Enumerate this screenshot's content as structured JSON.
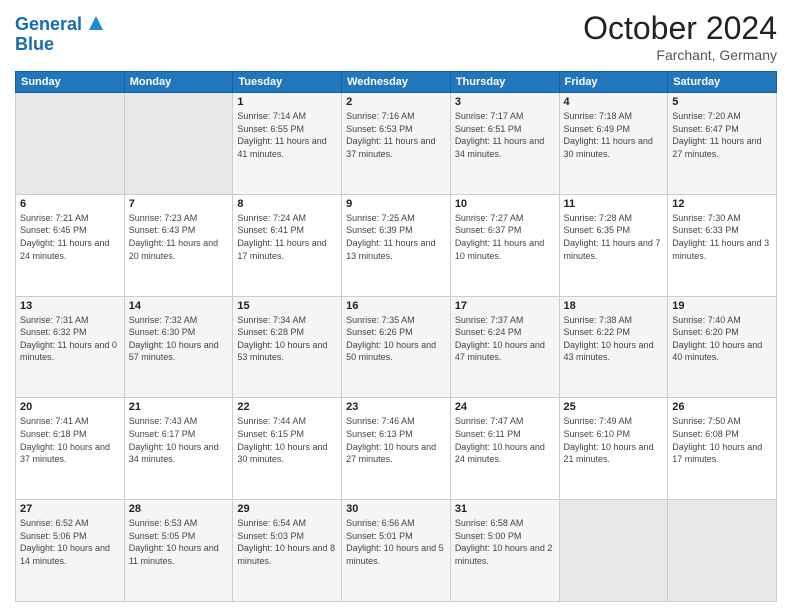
{
  "header": {
    "logo_line1": "General",
    "logo_line2": "Blue",
    "month": "October 2024",
    "location": "Farchant, Germany"
  },
  "weekdays": [
    "Sunday",
    "Monday",
    "Tuesday",
    "Wednesday",
    "Thursday",
    "Friday",
    "Saturday"
  ],
  "weeks": [
    [
      {
        "day": "",
        "info": ""
      },
      {
        "day": "",
        "info": ""
      },
      {
        "day": "1",
        "info": "Sunrise: 7:14 AM\nSunset: 6:55 PM\nDaylight: 11 hours and 41 minutes."
      },
      {
        "day": "2",
        "info": "Sunrise: 7:16 AM\nSunset: 6:53 PM\nDaylight: 11 hours and 37 minutes."
      },
      {
        "day": "3",
        "info": "Sunrise: 7:17 AM\nSunset: 6:51 PM\nDaylight: 11 hours and 34 minutes."
      },
      {
        "day": "4",
        "info": "Sunrise: 7:18 AM\nSunset: 6:49 PM\nDaylight: 11 hours and 30 minutes."
      },
      {
        "day": "5",
        "info": "Sunrise: 7:20 AM\nSunset: 6:47 PM\nDaylight: 11 hours and 27 minutes."
      }
    ],
    [
      {
        "day": "6",
        "info": "Sunrise: 7:21 AM\nSunset: 6:45 PM\nDaylight: 11 hours and 24 minutes."
      },
      {
        "day": "7",
        "info": "Sunrise: 7:23 AM\nSunset: 6:43 PM\nDaylight: 11 hours and 20 minutes."
      },
      {
        "day": "8",
        "info": "Sunrise: 7:24 AM\nSunset: 6:41 PM\nDaylight: 11 hours and 17 minutes."
      },
      {
        "day": "9",
        "info": "Sunrise: 7:25 AM\nSunset: 6:39 PM\nDaylight: 11 hours and 13 minutes."
      },
      {
        "day": "10",
        "info": "Sunrise: 7:27 AM\nSunset: 6:37 PM\nDaylight: 11 hours and 10 minutes."
      },
      {
        "day": "11",
        "info": "Sunrise: 7:28 AM\nSunset: 6:35 PM\nDaylight: 11 hours and 7 minutes."
      },
      {
        "day": "12",
        "info": "Sunrise: 7:30 AM\nSunset: 6:33 PM\nDaylight: 11 hours and 3 minutes."
      }
    ],
    [
      {
        "day": "13",
        "info": "Sunrise: 7:31 AM\nSunset: 6:32 PM\nDaylight: 11 hours and 0 minutes."
      },
      {
        "day": "14",
        "info": "Sunrise: 7:32 AM\nSunset: 6:30 PM\nDaylight: 10 hours and 57 minutes."
      },
      {
        "day": "15",
        "info": "Sunrise: 7:34 AM\nSunset: 6:28 PM\nDaylight: 10 hours and 53 minutes."
      },
      {
        "day": "16",
        "info": "Sunrise: 7:35 AM\nSunset: 6:26 PM\nDaylight: 10 hours and 50 minutes."
      },
      {
        "day": "17",
        "info": "Sunrise: 7:37 AM\nSunset: 6:24 PM\nDaylight: 10 hours and 47 minutes."
      },
      {
        "day": "18",
        "info": "Sunrise: 7:38 AM\nSunset: 6:22 PM\nDaylight: 10 hours and 43 minutes."
      },
      {
        "day": "19",
        "info": "Sunrise: 7:40 AM\nSunset: 6:20 PM\nDaylight: 10 hours and 40 minutes."
      }
    ],
    [
      {
        "day": "20",
        "info": "Sunrise: 7:41 AM\nSunset: 6:18 PM\nDaylight: 10 hours and 37 minutes."
      },
      {
        "day": "21",
        "info": "Sunrise: 7:43 AM\nSunset: 6:17 PM\nDaylight: 10 hours and 34 minutes."
      },
      {
        "day": "22",
        "info": "Sunrise: 7:44 AM\nSunset: 6:15 PM\nDaylight: 10 hours and 30 minutes."
      },
      {
        "day": "23",
        "info": "Sunrise: 7:46 AM\nSunset: 6:13 PM\nDaylight: 10 hours and 27 minutes."
      },
      {
        "day": "24",
        "info": "Sunrise: 7:47 AM\nSunset: 6:11 PM\nDaylight: 10 hours and 24 minutes."
      },
      {
        "day": "25",
        "info": "Sunrise: 7:49 AM\nSunset: 6:10 PM\nDaylight: 10 hours and 21 minutes."
      },
      {
        "day": "26",
        "info": "Sunrise: 7:50 AM\nSunset: 6:08 PM\nDaylight: 10 hours and 17 minutes."
      }
    ],
    [
      {
        "day": "27",
        "info": "Sunrise: 6:52 AM\nSunset: 5:06 PM\nDaylight: 10 hours and 14 minutes."
      },
      {
        "day": "28",
        "info": "Sunrise: 6:53 AM\nSunset: 5:05 PM\nDaylight: 10 hours and 11 minutes."
      },
      {
        "day": "29",
        "info": "Sunrise: 6:54 AM\nSunset: 5:03 PM\nDaylight: 10 hours and 8 minutes."
      },
      {
        "day": "30",
        "info": "Sunrise: 6:56 AM\nSunset: 5:01 PM\nDaylight: 10 hours and 5 minutes."
      },
      {
        "day": "31",
        "info": "Sunrise: 6:58 AM\nSunset: 5:00 PM\nDaylight: 10 hours and 2 minutes."
      },
      {
        "day": "",
        "info": ""
      },
      {
        "day": "",
        "info": ""
      }
    ]
  ]
}
